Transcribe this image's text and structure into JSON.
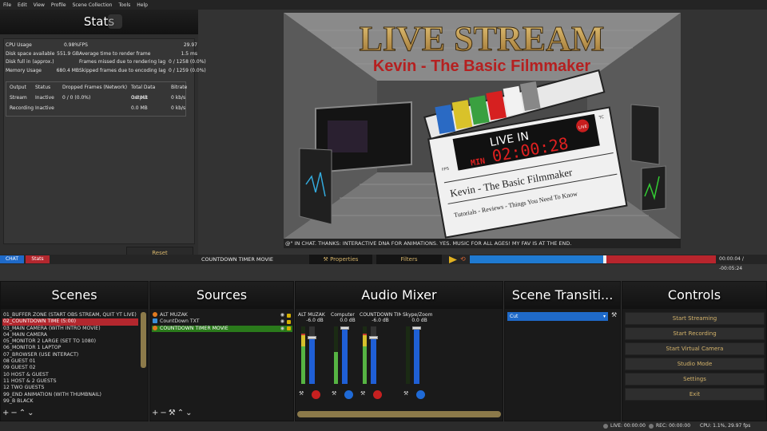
{
  "menu": [
    "File",
    "Edit",
    "View",
    "Profile",
    "Scene Collection",
    "Tools",
    "Help"
  ],
  "stats": {
    "title": "Stats",
    "rows": [
      [
        "CPU Usage",
        "0.98%",
        "FPS",
        "29.97"
      ],
      [
        "Disk space available",
        "551.9 GB",
        "Average time to render frame",
        "1.5 ms"
      ],
      [
        "Disk full in (approx.)",
        "",
        "Frames missed due to rendering lag",
        "0 / 1258 (0.0%)"
      ],
      [
        "Memory Usage",
        "680.4 MB",
        "Skipped frames due to encoding lag",
        "0 / 1259 (0.0%)"
      ]
    ],
    "output_headers": [
      "Output",
      "Status",
      "Dropped Frames (Network)",
      "Total Data Output",
      "Bitrate"
    ],
    "outputs": [
      [
        "Stream",
        "Inactive",
        "0 / 0 (0.0%)",
        "0.0 MB",
        "0 kb/s"
      ],
      [
        "Recording",
        "Inactive",
        "",
        "0.0 MB",
        "0 kb/s"
      ]
    ],
    "reset_label": "Reset"
  },
  "preview": {
    "banner_title": "LIVE STREAM",
    "banner_sub": "Kevin - The Basic Filmmaker",
    "clap_live": "LIVE IN",
    "clap_min": "MIN",
    "clap_time": "02:00:28",
    "clap_live_badge": "LIVE",
    "clap_tc": "TC",
    "clap_fps": "FPS",
    "clap_name": "Kevin - The Basic Filmmaker",
    "clap_tagline": "Tutorials - Reviews - Things You Need To Know",
    "ticker": "@\" IN CHAT.        THANKS: INTERACTIVE DNA FOR ANIMATIONS.        YES. MUSIC FOR ALL AGES! MY FAV IS AT THE END."
  },
  "context": {
    "tab_chat": "CHAT",
    "tab_stats": "Stats",
    "source_name": "COUNTDOWN TIMER MOVIE",
    "properties_label": "Properties",
    "filters_label": "Filters",
    "time": "00:00:04 / -00:05:24",
    "progress_fraction": 0.55
  },
  "scenes": {
    "title": "Scenes",
    "items": [
      "01_BUFFER ZONE (START OBS STREAM, QUIT YT LIVE)",
      "02_COUNTDOWN TIME (5:00)",
      "03_MAIN CAMERA (WITH INTRO MOVIE)",
      "04_MAIN CAMERA",
      "05_MONITOR 2 LARGE (SET TO 1080)",
      "06_MONITOR 1 LAPTOP",
      "07_BROWSER (USE INTERACT)",
      "08 GUEST 01",
      "09 GUEST 02",
      "10 HOST & GUEST",
      "11  HOST & 2 GUESTS",
      "12  TWO GUESTS",
      "99_END ANIMATION (WITH THUMBNAIL)",
      "99_B BLACK"
    ],
    "selected_index": 1
  },
  "sources": {
    "title": "Sources",
    "items": [
      "ALT MUZAK",
      "CountDown TXT",
      "COUNTDOWN TIMER MOVIE"
    ],
    "selected_index": 2
  },
  "mixer": {
    "title": "Audio Mixer",
    "channels": [
      {
        "name": "ALT MUZAK",
        "db": "-6.0 dB",
        "level": 0.88,
        "volume": 0.8
      },
      {
        "name": "Computer",
        "db": "0.0 dB",
        "level": 0.55,
        "volume": 0.97
      },
      {
        "name": "COUNTDOWN TIMER MOVIE",
        "db": "-6.0 dB",
        "level": 0.88,
        "volume": 0.8
      },
      {
        "name": "Skype/Zoom",
        "db": "0.0 dB",
        "level": 0.0,
        "volume": 0.97
      }
    ]
  },
  "transitions": {
    "title": "Scene Transiti...",
    "selected": "Cut"
  },
  "controls": {
    "title": "Controls",
    "buttons": [
      "Start Streaming",
      "Start Recording",
      "Start Virtual Camera",
      "Studio Mode",
      "Settings",
      "Exit"
    ]
  },
  "status": {
    "live": "LIVE: 00:00:00",
    "rec": "REC: 00:00:00",
    "cpu": "CPU: 1.1%, 29.97 fps"
  },
  "colors": {
    "accent_gold": "#d4b36a",
    "selection_red": "#b3272e",
    "selection_blue": "#1f6ac9",
    "source_green": "#2a7a1b"
  }
}
